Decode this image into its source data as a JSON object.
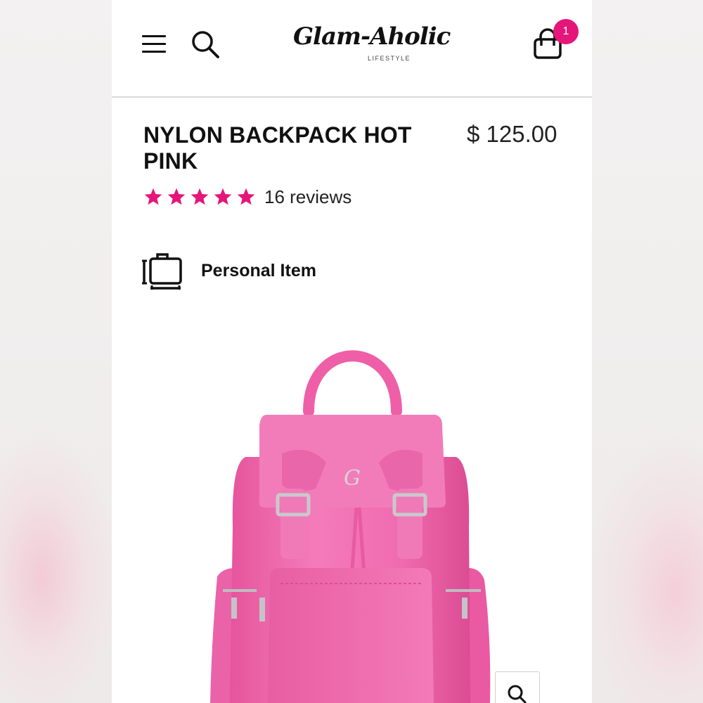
{
  "header": {
    "menu_icon": "hamburger-menu-icon",
    "search_icon": "search-icon",
    "logo_text": "Glam-Aholic",
    "logo_subtext": "LIFESTYLE",
    "cart_icon": "shopping-bag-icon",
    "cart_count": "1"
  },
  "product": {
    "title": "NYLON BACKPACK HOT PINK",
    "price": "$ 125.00",
    "rating": 5,
    "rating_max": 5,
    "reviews_label": "16 reviews",
    "size_label": "Personal Item",
    "size_icon": "luggage-icon",
    "image_alt": "pink nylon backpack",
    "zoom_icon": "zoom-icon"
  },
  "colors": {
    "accent": "#e5167a",
    "backpack": "#f06cb0",
    "text": "#111111"
  }
}
